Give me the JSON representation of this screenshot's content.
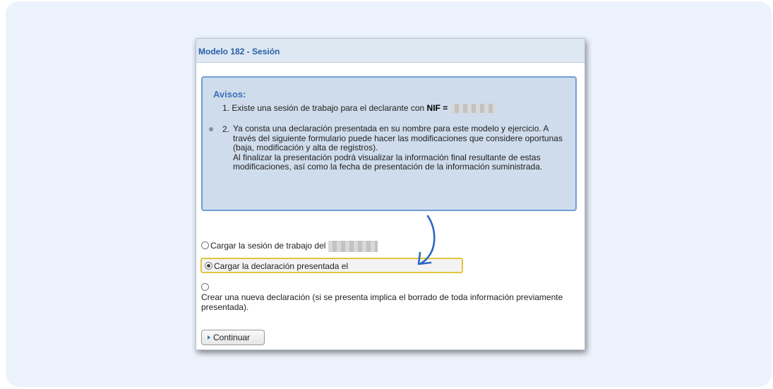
{
  "dialog": {
    "title": "Modelo 182 - Sesión"
  },
  "notice": {
    "heading": "Avisos:",
    "item1_prefix": "1. Existe una sesión de trabajo para el declarante con ",
    "item1_bold": "NIF =",
    "item2_number": "2.",
    "item2_para1": "Ya consta una declaración presentada en su nombre para este modelo y ejercicio. A través del siguiente formulario puede hacer las modificaciones que considere oportunas (baja, modificación y alta de registros).",
    "item2_para2": "Al finalizar la presentación podrá visualizar la información final resultante de estas modificaciones, así como la fecha de presentación de la información suministrada."
  },
  "options": {
    "load_session_label": "Cargar la sesión de trabajo del",
    "load_declaration_label": "Cargar la declaración presentada el",
    "new_declaration_label": "Crear una nueva declaración (si se presenta implica el borrado de toda información previamente presentada).",
    "selected": "load_declaration"
  },
  "buttons": {
    "continue_label": "Continuar"
  },
  "colors": {
    "title_text": "#2a5fa8",
    "notice_bg": "#cfdceb",
    "notice_border": "#6e9fd6",
    "highlight_border": "#e2c63c",
    "annotation_arrow": "#2c68c4"
  }
}
